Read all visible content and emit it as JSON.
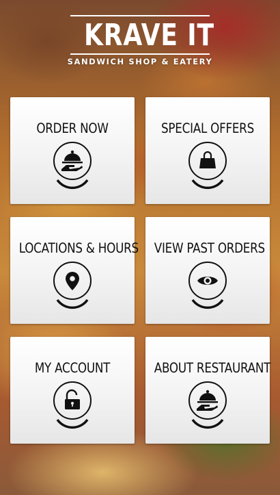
{
  "brand": {
    "title": "KRAVE IT",
    "subtitle": "SANDWICH SHOP & EATERY"
  },
  "menu": [
    {
      "label": "ORDER NOW",
      "icon": "serving-cloche-icon"
    },
    {
      "label": "SPECIAL OFFERS",
      "icon": "shopping-bag-icon"
    },
    {
      "label": "LOCATIONS & HOURS",
      "icon": "map-pin-icon"
    },
    {
      "label": "VIEW PAST ORDERS",
      "icon": "eye-icon"
    },
    {
      "label": "MY ACCOUNT",
      "icon": "unlocked-padlock-icon"
    },
    {
      "label": "ABOUT RESTAURANT",
      "icon": "serving-cloche-icon"
    }
  ]
}
